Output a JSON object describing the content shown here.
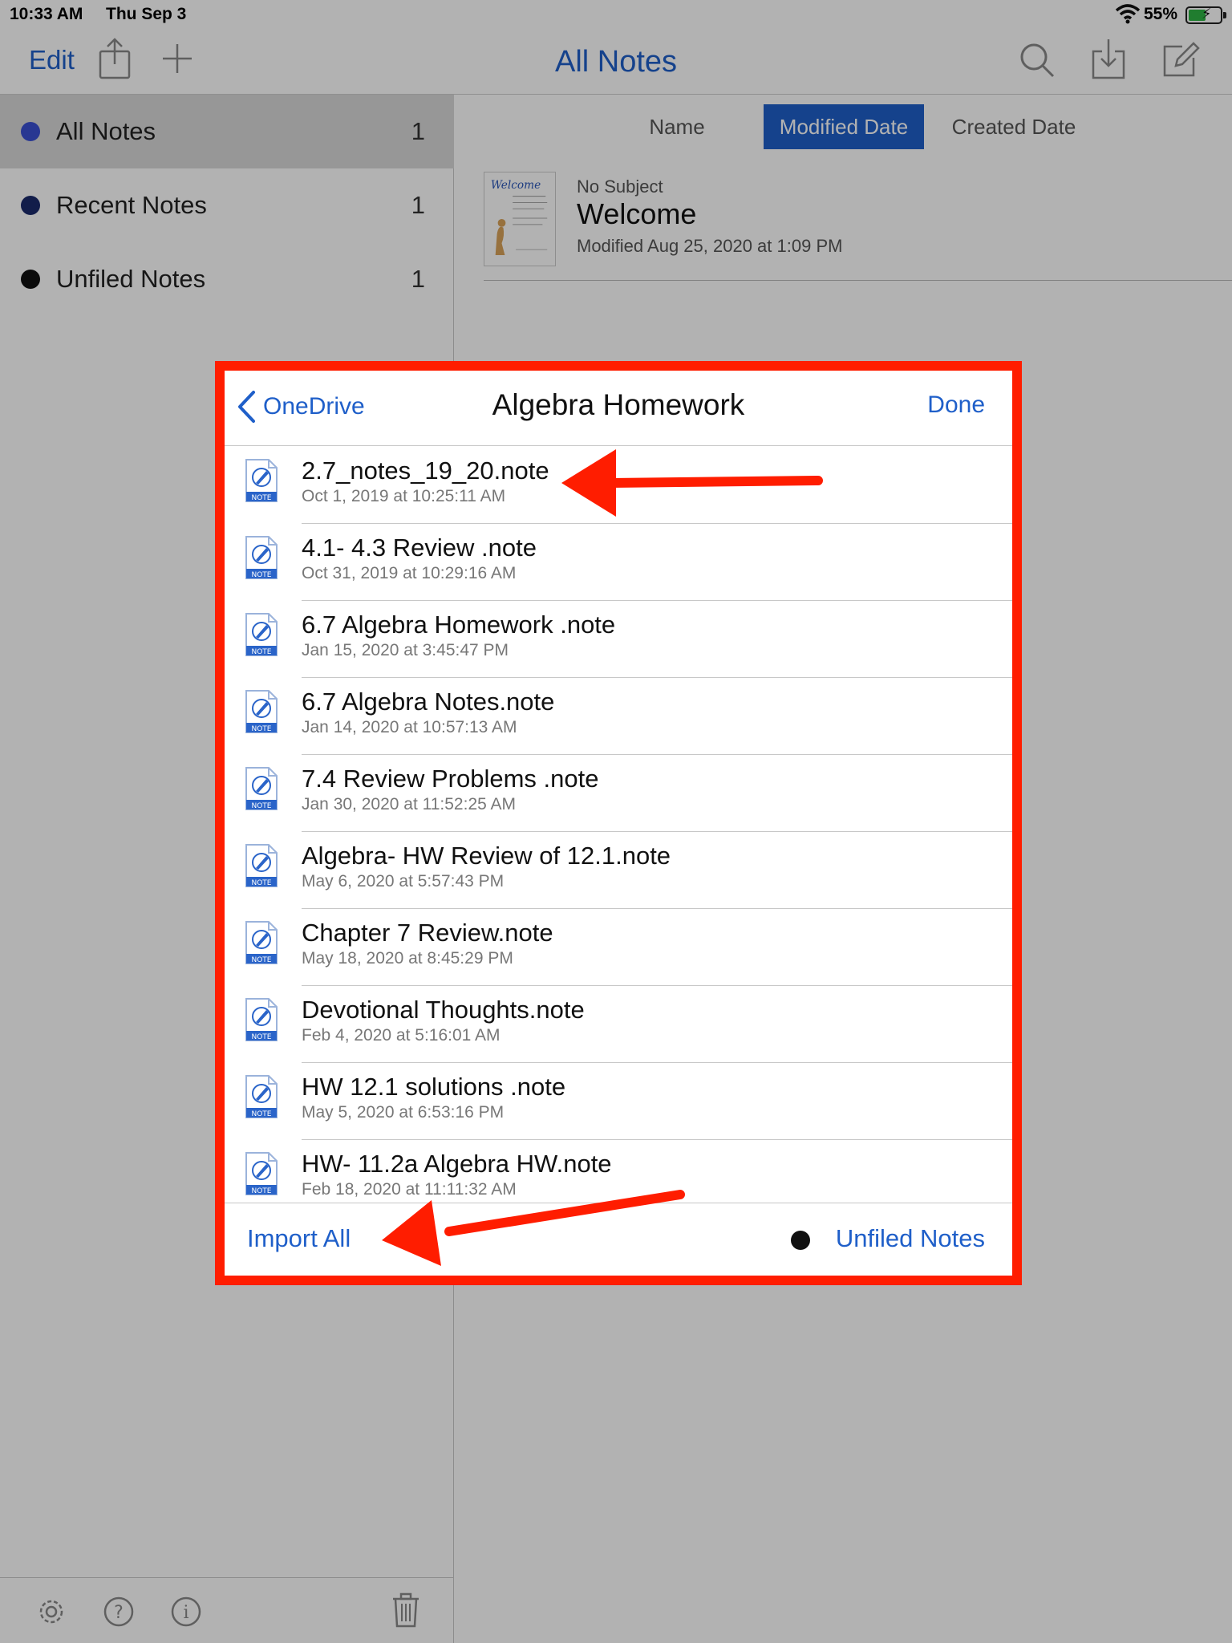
{
  "status_bar": {
    "time": "10:33 AM",
    "date": "Thu Sep 3",
    "battery_percent": "55%",
    "battery_level": 0.55
  },
  "nav": {
    "edit_label": "Edit",
    "title": "All Notes",
    "icons": [
      "share-icon",
      "add-icon",
      "search-icon",
      "import-icon",
      "compose-icon"
    ]
  },
  "sidebar": {
    "items": [
      {
        "label": "All Notes",
        "count": "1",
        "dot_color": "#3a4fd1",
        "selected": true
      },
      {
        "label": "Recent Notes",
        "count": "1",
        "dot_color": "#1b2a6b",
        "selected": false
      },
      {
        "label": "Unfiled Notes",
        "count": "1",
        "dot_color": "#111111",
        "selected": false
      }
    ],
    "footer_icons": [
      "settings-icon",
      "help-icon",
      "info-icon",
      "trash-icon"
    ]
  },
  "sort": {
    "options": [
      "Name",
      "Modified Date",
      "Created Date"
    ],
    "active": "Modified Date"
  },
  "note": {
    "subject": "No Subject",
    "title": "Welcome",
    "modified": "Modified Aug 25, 2020 at 1:09 PM",
    "thumbnail_text": "Welcome"
  },
  "modal": {
    "back_label": "OneDrive",
    "title": "Algebra Homework",
    "done_label": "Done",
    "files": [
      {
        "name": "2.7_notes_19_20.note",
        "date": "Oct 1, 2019 at 10:25:11 AM"
      },
      {
        "name": "4.1- 4.3 Review .note",
        "date": "Oct 31, 2019 at 10:29:16 AM"
      },
      {
        "name": "6.7 Algebra Homework .note",
        "date": "Jan 15, 2020 at 3:45:47 PM"
      },
      {
        "name": "6.7 Algebra Notes.note",
        "date": "Jan 14, 2020 at 10:57:13 AM"
      },
      {
        "name": "7.4 Review Problems .note",
        "date": "Jan 30, 2020 at 11:52:25 AM"
      },
      {
        "name": "Algebra- HW Review of 12.1.note",
        "date": "May 6, 2020 at 5:57:43 PM"
      },
      {
        "name": "Chapter 7 Review.note",
        "date": "May 18, 2020 at 8:45:29 PM"
      },
      {
        "name": "Devotional Thoughts.note",
        "date": "Feb 4, 2020 at 5:16:01 AM"
      },
      {
        "name": "HW 12.1 solutions .note",
        "date": "May 5, 2020 at 6:53:16 PM"
      },
      {
        "name": "HW- 11.2a Algebra HW.note",
        "date": "Feb 18, 2020 at 11:11:32 AM"
      }
    ],
    "file_icon_label": "NOTE",
    "import_all_label": "Import All",
    "folder_label": "Unfiled Notes"
  },
  "colors": {
    "accent": "#1f5fc9",
    "highlight": "#ff1d00",
    "battery": "#2fb344"
  }
}
